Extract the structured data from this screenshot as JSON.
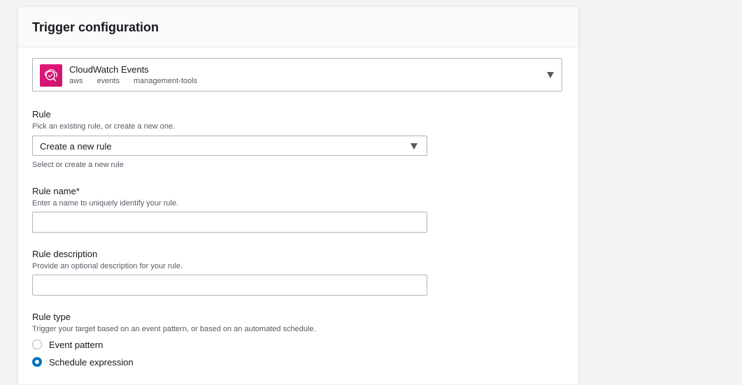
{
  "panel": {
    "title": "Trigger configuration"
  },
  "trigger": {
    "name": "CloudWatch Events",
    "tags": [
      "aws",
      "events",
      "management-tools"
    ],
    "icon": "cloudwatch-events-icon",
    "icon_color": "#e7157b"
  },
  "rule": {
    "label": "Rule",
    "description": "Pick an existing rule, or create a new one.",
    "selected": "Create a new rule",
    "hint": "Select or create a new rule"
  },
  "rule_name": {
    "label": "Rule name*",
    "description": "Enter a name to uniquely identify your rule.",
    "value": ""
  },
  "rule_description": {
    "label": "Rule description",
    "description": "Provide an optional description for your rule.",
    "value": ""
  },
  "rule_type": {
    "label": "Rule type",
    "description": "Trigger your target based on an event pattern, or based on an automated schedule.",
    "options": [
      {
        "label": "Event pattern",
        "checked": false
      },
      {
        "label": "Schedule expression",
        "checked": true
      }
    ]
  },
  "colors": {
    "accent": "#0073bb",
    "border": "#aab7b8",
    "muted_text": "#545b64"
  }
}
